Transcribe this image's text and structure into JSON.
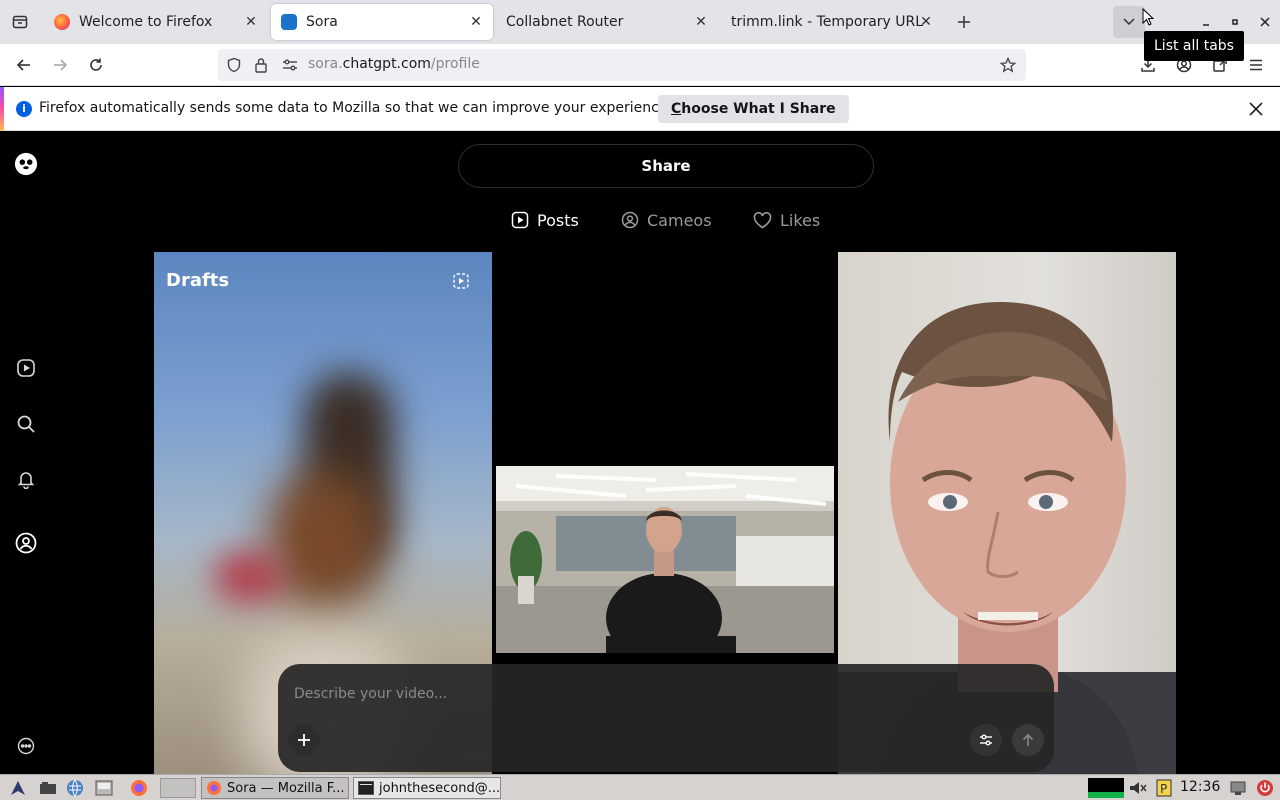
{
  "browser": {
    "tabs": [
      {
        "title": "Welcome to Firefox",
        "favicon": "firefox-icon",
        "active": false
      },
      {
        "title": "Sora",
        "favicon": "sora-icon",
        "active": true
      },
      {
        "title": "Collabnet Router",
        "favicon": "",
        "active": false
      },
      {
        "title": "trimm.link - Temporary URL",
        "favicon": "",
        "active": false
      }
    ],
    "url_host": "sora.",
    "url_domain": "chatgpt.com",
    "url_path": "/profile",
    "tooltip": "List all tabs",
    "notification": {
      "message": "Firefox automatically sends some data to Mozilla so that we can improve your experience.",
      "button_first_letter": "C",
      "button_rest": "hoose What I Share"
    }
  },
  "sora": {
    "share_label": "Share",
    "profile_tabs": [
      {
        "label": "Posts",
        "icon": "play-square-icon",
        "active": true
      },
      {
        "label": "Cameos",
        "icon": "user-circle-icon",
        "active": false
      },
      {
        "label": "Likes",
        "icon": "heart-icon",
        "active": false
      }
    ],
    "drafts_label": "Drafts",
    "prompt_placeholder": "Describe your video..."
  },
  "taskbar": {
    "tasks": [
      {
        "label": "Sora — Mozilla F..."
      },
      {
        "label": "johnthesecond@..."
      }
    ],
    "clock": "12:36"
  },
  "colors": {
    "firefox_info_blue": "#0060df",
    "page_bg": "#000000"
  }
}
